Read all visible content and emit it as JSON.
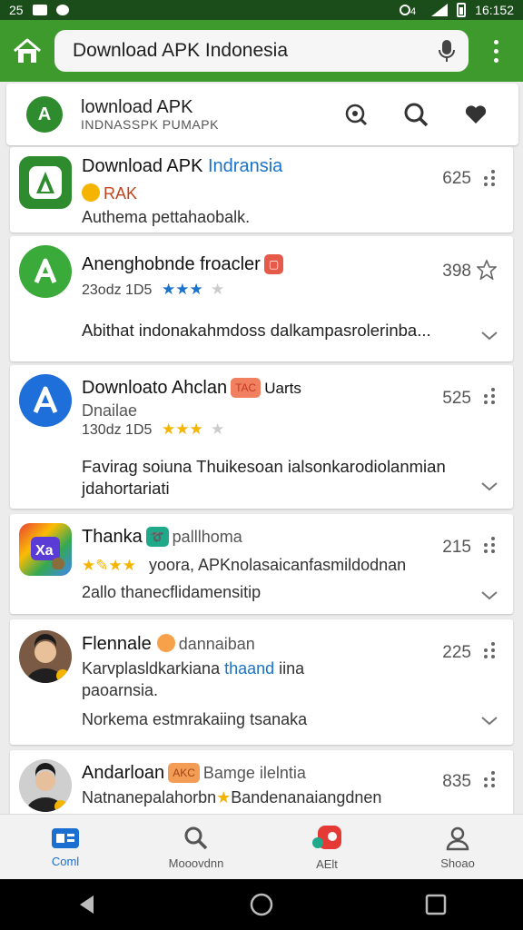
{
  "status_bar": {
    "left_text": "25",
    "time": "16:152"
  },
  "app_bar": {
    "search_text": "Download APK Indonesia"
  },
  "header": {
    "logo": "A",
    "title": "lownload APK",
    "subtitle": "INDNASSPK PUMAPK"
  },
  "items": [
    {
      "title": "Download APK ",
      "title_highlight": "Indransia",
      "line1": "RAK",
      "desc": "Authema pettahaobalk.",
      "count": "625",
      "icon_color": "#2e8b2e"
    },
    {
      "title": "Anenghobnde froacler",
      "meta": "23odz 1D5",
      "rating": 3,
      "desc": "Abithat indonakahmdoss dalkampasrolerinba...",
      "count": "398",
      "icon_color": "#3aaa3a"
    },
    {
      "title": "Downloato Ahclan",
      "badge": "TAC",
      "title_suffix": "Uarts",
      "sub": "Dnailae",
      "meta": "130dz 1D5",
      "rating": 3,
      "desc": "Favirag soiuna Thuikesoan ialsonkarodiolanmian jdahortariati",
      "count": "525",
      "icon_color": "#1e6fd9"
    },
    {
      "title": "Thanka",
      "title_suffix": "palllhoma",
      "line1": "yoora, APKnolasaicanfasmildodnan",
      "line2": "2allo thanecflidamensitip",
      "count": "215"
    },
    {
      "title": "Flennale",
      "title_suffix": "dannaiban",
      "line1": "Karvplasl",
      "line1_mid": "dkarkiana ",
      "line1_blue": "thaand",
      "line1_end": " iina",
      "line2": "paoarnsia.",
      "desc": "Norkema estmrakaiing tsanaka",
      "count": "225"
    },
    {
      "title": "Andarloan",
      "badge": "AKC",
      "title_suffix": "Bamge ilelntia",
      "line1": "Natnanepalahorbn",
      "line1_end": "Bandenanaiangdnen",
      "count": "835"
    }
  ],
  "bottom_nav": [
    {
      "label": "Coml",
      "icon": "home-icon",
      "active": true
    },
    {
      "label": "Mooovdnn",
      "icon": "search-icon",
      "active": false
    },
    {
      "label": "AElt",
      "icon": "notification-icon",
      "active": false
    },
    {
      "label": "Shoao",
      "icon": "profile-icon",
      "active": false
    }
  ],
  "colors": {
    "accent": "#3f9a2e",
    "blue": "#1a73c8",
    "star": "#f4b400"
  }
}
